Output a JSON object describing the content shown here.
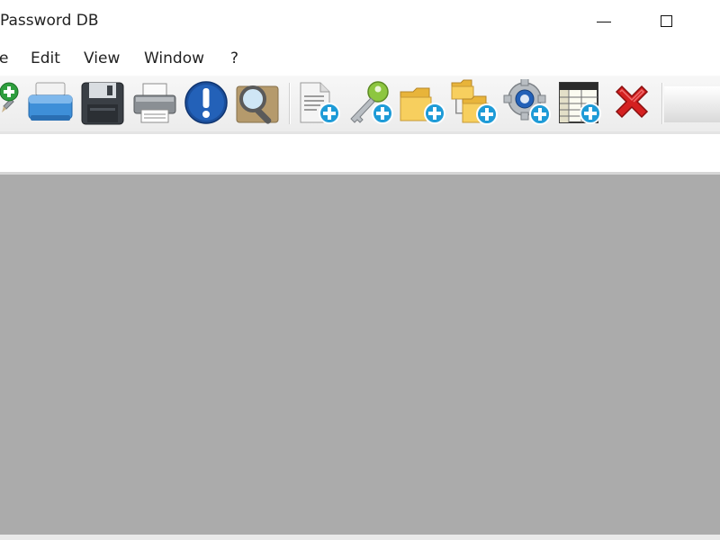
{
  "window": {
    "title": "Password DB"
  },
  "menu": {
    "items": [
      {
        "id": "file",
        "label": "e"
      },
      {
        "id": "edit",
        "label": "Edit"
      },
      {
        "id": "view",
        "label": "View"
      },
      {
        "id": "window",
        "label": "Window"
      },
      {
        "id": "help",
        "label": "?"
      }
    ]
  },
  "toolbar": {
    "buttons": [
      {
        "icon": "new-database-icon"
      },
      {
        "icon": "scanner-icon"
      },
      {
        "icon": "save-disk-icon"
      },
      {
        "icon": "printer-icon"
      },
      {
        "icon": "info-exclamation-icon"
      },
      {
        "icon": "search-magnifier-icon"
      },
      {
        "icon": "add-record-icon"
      },
      {
        "icon": "add-key-icon"
      },
      {
        "icon": "add-folder-icon"
      },
      {
        "icon": "add-subfolder-icon"
      },
      {
        "icon": "add-settings-icon"
      },
      {
        "icon": "add-table-icon"
      },
      {
        "icon": "delete-x-icon"
      }
    ]
  },
  "colors": {
    "workspace": "#ababab",
    "plus_badge": "#1e9bd7",
    "delete_red": "#d42020"
  }
}
